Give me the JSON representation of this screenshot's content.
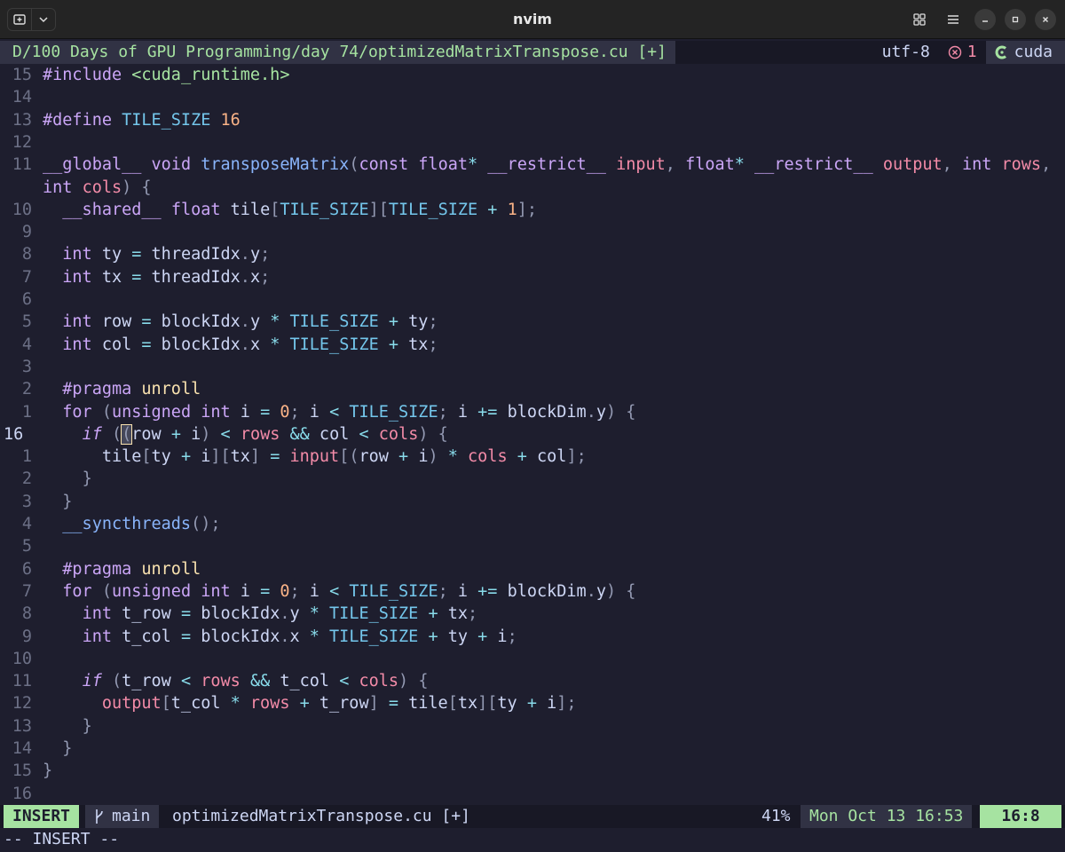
{
  "window": {
    "title": "nvim"
  },
  "tabline": {
    "path": "D/100 Days of GPU Programming/day 74/optimizedMatrixTranspose.cu [+]",
    "encoding": "utf-8",
    "error_count": "1",
    "filetype": "cuda"
  },
  "status": {
    "mode": "INSERT",
    "branch": "main",
    "file": "optimizedMatrixTranspose.cu [+]",
    "percent": "41%",
    "datetime": "Mon Oct 13 16:53",
    "position": "16:8"
  },
  "cmdline": "-- INSERT --",
  "colors": {
    "background": "#1e1e2e",
    "mode_green": "#a6e3a1",
    "keyword": "#cba6f7",
    "function": "#89b4fa",
    "error": "#f38ba8"
  },
  "lines": [
    {
      "num": "15",
      "text": "#include <cuda_runtime.h>"
    },
    {
      "num": "14",
      "text": ""
    },
    {
      "num": "13",
      "text": "#define TILE_SIZE 16"
    },
    {
      "num": "12",
      "text": ""
    },
    {
      "num": "11",
      "text": "__global__ void transposeMatrix(const float* __restrict__ input, float* __restrict__ output, int rows,"
    },
    {
      "num": "",
      "text": "int cols) {"
    },
    {
      "num": "10",
      "text": "  __shared__ float tile[TILE_SIZE][TILE_SIZE + 1];"
    },
    {
      "num": "9",
      "text": ""
    },
    {
      "num": "8",
      "text": "  int ty = threadIdx.y;"
    },
    {
      "num": "7",
      "text": "  int tx = threadIdx.x;"
    },
    {
      "num": "6",
      "text": ""
    },
    {
      "num": "5",
      "text": "  int row = blockIdx.y * TILE_SIZE + ty;"
    },
    {
      "num": "4",
      "text": "  int col = blockIdx.x * TILE_SIZE + tx;"
    },
    {
      "num": "3",
      "text": ""
    },
    {
      "num": "2",
      "text": "  #pragma unroll"
    },
    {
      "num": "1",
      "text": "  for (unsigned int i = 0; i < TILE_SIZE; i += blockDim.y) {"
    },
    {
      "num": "16",
      "text": "    if ((row + i) < rows && col < cols) {"
    },
    {
      "num": "1",
      "text": "      tile[ty + i][tx] = input[(row + i) * cols + col];"
    },
    {
      "num": "2",
      "text": "    }"
    },
    {
      "num": "3",
      "text": "  }"
    },
    {
      "num": "4",
      "text": "  __syncthreads();"
    },
    {
      "num": "5",
      "text": ""
    },
    {
      "num": "6",
      "text": "  #pragma unroll"
    },
    {
      "num": "7",
      "text": "  for (unsigned int i = 0; i < TILE_SIZE; i += blockDim.y) {"
    },
    {
      "num": "8",
      "text": "    int t_row = blockIdx.y * TILE_SIZE + tx;"
    },
    {
      "num": "9",
      "text": "    int t_col = blockIdx.x * TILE_SIZE + ty + i;"
    },
    {
      "num": "10",
      "text": ""
    },
    {
      "num": "11",
      "text": "    if (t_row < rows && t_col < cols) {"
    },
    {
      "num": "12",
      "text": "      output[t_col * rows + t_row] = tile[tx][ty + i];"
    },
    {
      "num": "13",
      "text": "    }"
    },
    {
      "num": "14",
      "text": "  }"
    },
    {
      "num": "15",
      "text": "}"
    },
    {
      "num": "16",
      "text": ""
    }
  ]
}
